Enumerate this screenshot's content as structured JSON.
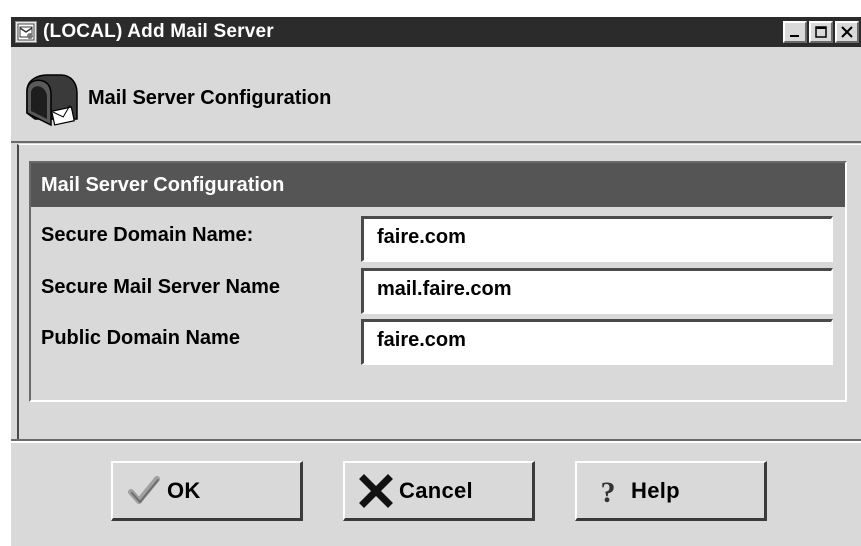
{
  "window": {
    "title": "(LOCAL) Add Mail Server"
  },
  "header": {
    "title": "Mail Server Configuration"
  },
  "panel": {
    "title": "Mail Server Configuration",
    "fields": [
      {
        "label": "Secure Domain Name:",
        "value": "faire.com"
      },
      {
        "label": "Secure Mail Server Name",
        "value": "mail.faire.com"
      },
      {
        "label": "Public Domain Name",
        "value": "faire.com"
      }
    ]
  },
  "buttons": {
    "ok_label": "OK",
    "cancel_label": "Cancel",
    "help_label": "Help"
  },
  "colors": {
    "titlebar_bg": "#2b2b2b",
    "window_bg": "#d9d9d9",
    "panel_header_bg": "#555555",
    "ok_check": "#a0a0a0"
  }
}
